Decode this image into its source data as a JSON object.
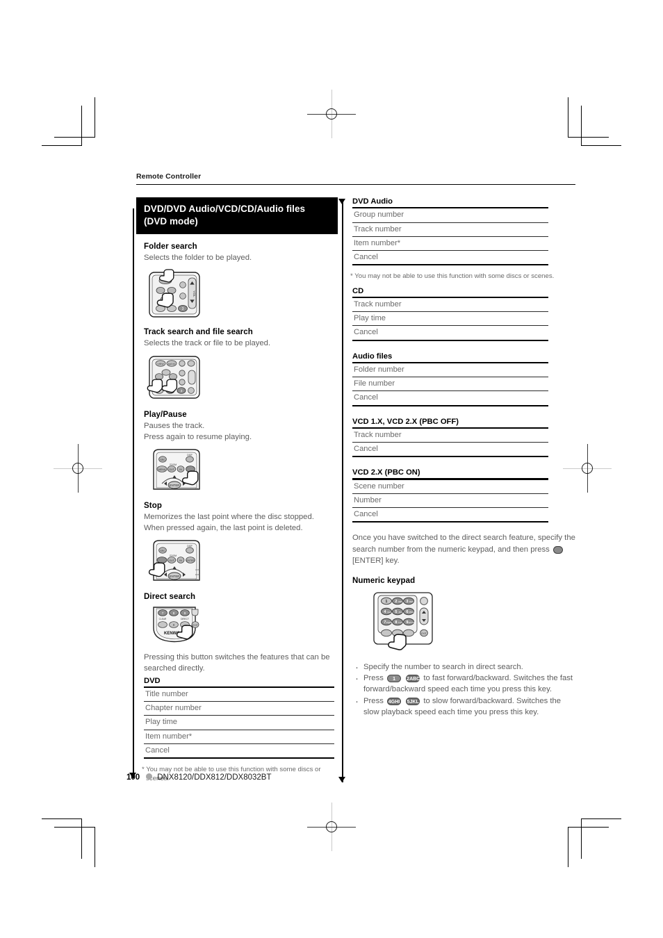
{
  "page": {
    "running_head": "Remote Controller",
    "footer": {
      "page_number": "100",
      "models": "DNX8120/DDX812/DDX8032BT"
    }
  },
  "left_column": {
    "banner": "DVD/DVD Audio/VCD/CD/Audio files (DVD mode)",
    "sections": [
      {
        "heading": "Folder search",
        "description": "Selects the folder to be played.",
        "illustration": "remote-folder-search"
      },
      {
        "heading": "Track search and file search",
        "description": "Selects the track or file to be played.",
        "illustration": "remote-track-search"
      },
      {
        "heading": "Play/Pause",
        "description": "Pauses the track.\nPress again to resume playing.",
        "illustration": "remote-play-pause"
      },
      {
        "heading": "Stop",
        "description": "Memorizes the last point where the disc stopped.\nWhen pressed again, the last point is deleted.",
        "illustration": "remote-stop"
      },
      {
        "heading": "Direct search",
        "description": "",
        "illustration": "remote-direct-search"
      }
    ],
    "direct_search_body": "Pressing this button switches the features that can be searched directly.",
    "dvd_table": {
      "title": "DVD",
      "rows": [
        "Title number",
        "Chapter number",
        "Play time",
        "Item number*",
        "Cancel"
      ]
    },
    "footnote": "* You may not be able to use this function with some discs or scenes."
  },
  "right_column": {
    "dvd_audio_table": {
      "title": "DVD Audio",
      "rows": [
        "Group number",
        "Track number",
        "Item number*",
        "Cancel"
      ]
    },
    "dvd_audio_footnote": "* You may not be able to use this function with some discs or scenes.",
    "cd_table": {
      "title": "CD",
      "rows": [
        "Track number",
        "Play time",
        "Cancel"
      ]
    },
    "audio_files_table": {
      "title": "Audio files",
      "rows": [
        "Folder number",
        "File number",
        "Cancel"
      ]
    },
    "vcd_pbc_off_table": {
      "title": "VCD 1.X, VCD 2.X (PBC OFF)",
      "rows": [
        "Track number",
        "Cancel"
      ]
    },
    "vcd_pbc_on_table": {
      "title": "VCD 2.X (PBC ON)",
      "rows": [
        "Scene number",
        "Number",
        "Cancel"
      ]
    },
    "direct_search_note_part1": "Once you have switched to the direct search feature, specify the search number from the numeric keypad, and then press",
    "direct_search_note_part2": "[ENTER] key.",
    "numeric_keypad_heading": "Numeric keypad",
    "numeric_keypad_illustration": "remote-numeric-keypad",
    "bullets": [
      {
        "text_before": "Specify the number to search in direct search.",
        "keys": [],
        "text_after": ""
      },
      {
        "text_before": "Press",
        "keys": [
          "1",
          "2ABC"
        ],
        "text_after": "to fast forward/backward. Switches the fast forward/backward speed each time you press this key."
      },
      {
        "text_before": "Press",
        "keys": [
          "4GHI",
          "5JKL"
        ],
        "text_after": "to slow forward/backward. Switches the slow playback speed each time you press this key."
      }
    ]
  },
  "colors": {
    "banner_background": "#000000",
    "banner_text": "#ffffff",
    "body_text": "#5d5d5d",
    "rule": "#000000",
    "footer_dot": "#a8a8a8"
  }
}
